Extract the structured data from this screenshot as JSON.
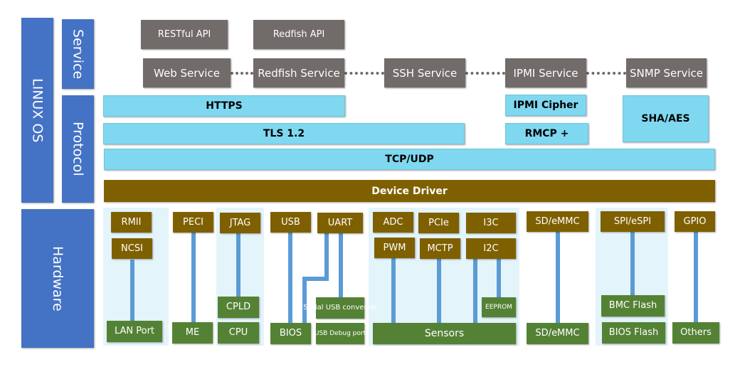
{
  "layers": {
    "os": "LINUX OS",
    "service": "Service",
    "protocol": "Protocol",
    "hardware": "Hardware"
  },
  "apis": [
    "RESTful API",
    "Redfish API"
  ],
  "services": [
    "Web Service",
    "Redfish Service",
    "SSH Service",
    "IPMI Service",
    "SNMP Service"
  ],
  "protocols": {
    "https": "HTTPS",
    "tls": "TLS 1.2",
    "ipmi_cipher": "IPMI Cipher",
    "rmcp": "RMCP +",
    "sha_aes": "SHA/AES",
    "tcp_udp": "TCP/UDP"
  },
  "driver": "Device Driver",
  "interfaces": {
    "rmii": "RMII",
    "ncsi": "NCSI",
    "peci": "PECI",
    "jtag": "JTAG",
    "usb": "USB",
    "uart": "UART",
    "adc": "ADC",
    "pcie": "PCIe",
    "i3c": "I3C",
    "pwm": "PWM",
    "mctp": "MCTP",
    "i2c": "I2C",
    "sd_emmc": "SD/eMMC",
    "spi_espi": "SPI/eSPI",
    "gpio": "GPIO"
  },
  "devices": {
    "lan_port": "LAN Port",
    "me": "ME",
    "cpld": "CPLD",
    "cpu": "CPU",
    "bios": "BIOS",
    "serial_usb": "Serial USB converter",
    "usb_debug": "USB Debug port",
    "eeprom": "EEPROM",
    "sensors": "Sensors",
    "sd_emmc": "SD/eMMC",
    "bmc_flash": "BMC Flash",
    "bios_flash": "BIOS Flash",
    "others": "Others"
  },
  "colors": {
    "layer": "#4472c4",
    "service": "#716b6a",
    "protocol": "#7fd8f0",
    "driver": "#7f6000",
    "device": "#548235",
    "connector": "#5b9bd5",
    "panel": "#e4f4fb"
  }
}
